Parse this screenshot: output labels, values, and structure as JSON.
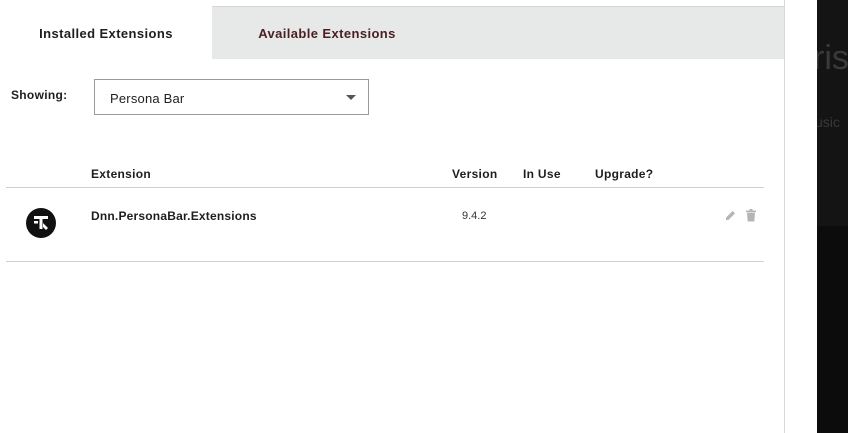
{
  "tabs": {
    "installed": "Installed Extensions",
    "available": "Available Extensions"
  },
  "filter": {
    "label": "Showing:",
    "selected": "Persona Bar"
  },
  "table": {
    "columns": [
      "Extension",
      "Version",
      "In Use",
      "Upgrade?"
    ],
    "rows": [
      {
        "name": "Dnn.PersonaBar.Extensions",
        "version": "9.4.2",
        "in_use": "",
        "upgrade": ""
      }
    ]
  },
  "icons": {
    "extension": "persona-bar-logo-icon",
    "edit": "pencil-icon",
    "delete": "trash-icon",
    "dropdown": "caret-down-icon"
  },
  "background_peek": {
    "title": "ris",
    "subtitle": "usic"
  },
  "colors": {
    "tabstrip": "#e7e8e8",
    "available_tab_text": "#4a1f1f",
    "action_icon": "#b5b5b5"
  }
}
